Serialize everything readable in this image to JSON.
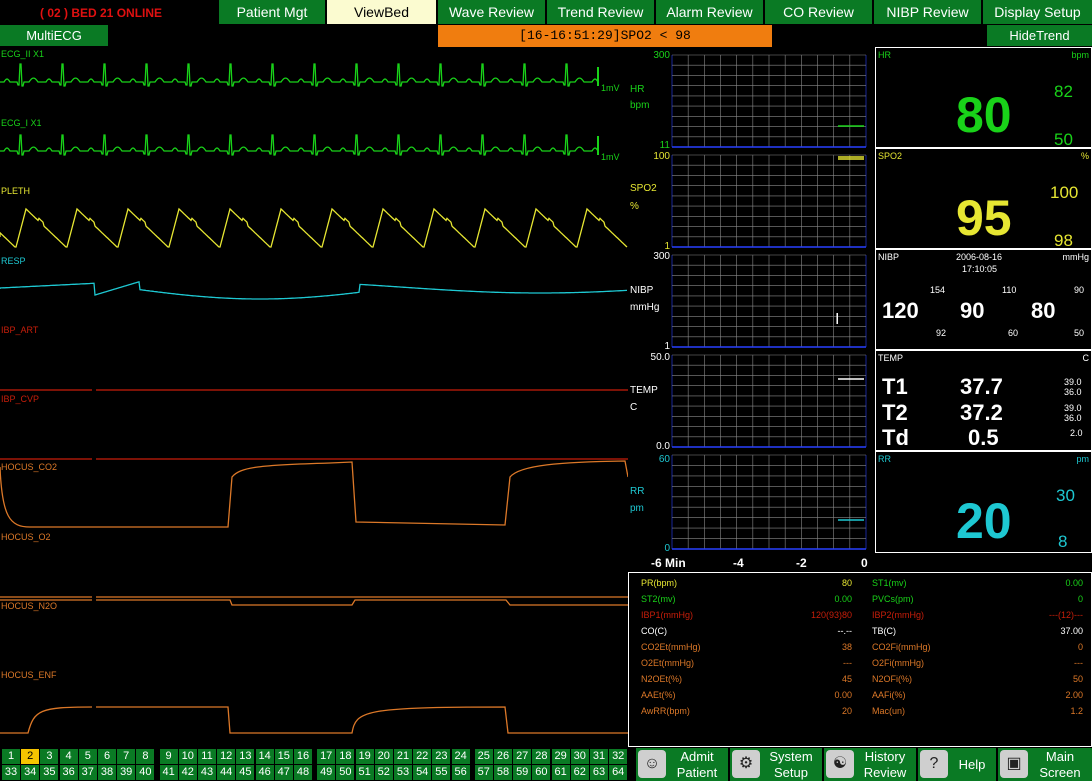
{
  "header": {
    "bed_status": "( 02 ) BED 21 ONLINE",
    "tabs": [
      {
        "label": "Patient Mgt",
        "active": false
      },
      {
        "label": "ViewBed",
        "active": true
      },
      {
        "label": "Wave Review",
        "active": false
      },
      {
        "label": "Trend Review",
        "active": false
      },
      {
        "label": "Alarm Review",
        "active": false
      },
      {
        "label": "CO Review",
        "active": false
      },
      {
        "label": "NIBP Review",
        "active": false
      },
      {
        "label": "Display Setup",
        "active": false
      }
    ],
    "multi_ecg": "MultiECG",
    "alarm": "[16-16:51:29]SPO2 < 98",
    "hide_trend": "HideTrend"
  },
  "colors": {
    "green": "#19d219",
    "yellow": "#e6e632",
    "cyan": "#1ec8d2",
    "red": "#c81e0a",
    "orange": "#dc7828",
    "menu_green": "#0a7a24",
    "grid_blue": "#1428d2"
  },
  "waves": [
    {
      "label": "ECG_II   X1",
      "color": "#19d219"
    },
    {
      "label": "ECG_I   X1",
      "color": "#19d219"
    },
    {
      "label": "PLETH",
      "color": "#e6e632"
    },
    {
      "label": "RESP",
      "color": "#1ec8d2"
    },
    {
      "label": "IBP_ART",
      "color": "#c81e0a"
    },
    {
      "label": "IBP_CVP",
      "color": "#c81e0a"
    },
    {
      "label": "HOCUS_CO2",
      "color": "#dc7828"
    },
    {
      "label": "HOCUS_O2",
      "color": "#dc7828"
    },
    {
      "label": "HOCUS_N2O",
      "color": "#dc7828"
    },
    {
      "label": "HOCUS_ENF",
      "color": "#dc7828"
    }
  ],
  "ecg_scale": "1mV",
  "trends": [
    {
      "name": "HR",
      "unit": "bpm",
      "top": "300",
      "bottom": "11",
      "color": "#19d219"
    },
    {
      "name": "SPO2",
      "unit": "%",
      "top": "100",
      "bottom": "1",
      "color": "#e6e632"
    },
    {
      "name": "NIBP",
      "unit": "mmHg",
      "top": "300",
      "bottom": "1",
      "color": "#ffffff"
    },
    {
      "name": "TEMP",
      "unit": "C",
      "top": "50.0",
      "bottom": "0.0",
      "color": "#ffffff"
    },
    {
      "name": "RR",
      "unit": "pm",
      "top": "60",
      "bottom": "0",
      "color": "#1ec8d2"
    }
  ],
  "trend_axis": [
    "-6 Min",
    "-4",
    "-2",
    "0"
  ],
  "params": {
    "hr": {
      "title": "HR",
      "unit": "bpm",
      "value": "80",
      "hi": "82",
      "lo": "50"
    },
    "spo2": {
      "title": "SPO2",
      "unit": "%",
      "value": "95",
      "hi": "100",
      "lo": "98"
    },
    "nibp": {
      "title": "NIBP",
      "unit": "mmHg",
      "date": "2006-08-16",
      "time": "17:10:05",
      "sys": "120",
      "dia": "90",
      "map": "80",
      "sys_hi": "154",
      "sys_lo": "92",
      "dia_hi": "110",
      "dia_lo": "60",
      "map_hi": "90",
      "map_lo": "50"
    },
    "temp": {
      "title": "TEMP",
      "unit": "C",
      "t1_label": "T1",
      "t1": "37.7",
      "t1_hi": "39.0",
      "t1_lo": "36.0",
      "t2_label": "T2",
      "t2": "37.2",
      "t2_hi": "39.0",
      "t2_lo": "36.0",
      "td_label": "Td",
      "td": "0.5",
      "td_hi": "2.0"
    },
    "rr": {
      "title": "RR",
      "unit": "pm",
      "value": "20",
      "hi": "30",
      "lo": "8"
    }
  },
  "table_left": [
    {
      "label": "PR(bpm)",
      "value": "80",
      "color": "#e6e632"
    },
    {
      "label": "ST2(mv)",
      "value": "0.00",
      "color": "#19d219"
    },
    {
      "label": "IBP1(mmHg)",
      "value": "120(93)80",
      "color": "#c81e0a"
    },
    {
      "label": "CO(C)",
      "value": "--.--",
      "color": "#ffffff"
    },
    {
      "label": "CO2Et(mmHg)",
      "value": "38",
      "color": "#dc7828"
    },
    {
      "label": "O2Et(mmHg)",
      "value": "---",
      "color": "#dc7828"
    },
    {
      "label": "N2OEt(%)",
      "value": "45",
      "color": "#dc7828"
    },
    {
      "label": "AAEt(%)",
      "value": "0.00",
      "color": "#dc7828"
    },
    {
      "label": "AwRR(bpm)",
      "value": "20",
      "color": "#dc7828"
    }
  ],
  "table_right": [
    {
      "label": "ST1(mv)",
      "value": "0.00",
      "color": "#19d219"
    },
    {
      "label": "PVCs(pm)",
      "value": "0",
      "color": "#19d219"
    },
    {
      "label": "IBP2(mmHg)",
      "value": "---(12)---",
      "color": "#c81e0a"
    },
    {
      "label": "TB(C)",
      "value": "37.00",
      "color": "#ffffff"
    },
    {
      "label": "CO2Fi(mmHg)",
      "value": "0",
      "color": "#dc7828"
    },
    {
      "label": "O2Fi(mmHg)",
      "value": "---",
      "color": "#dc7828"
    },
    {
      "label": "N2OFi(%)",
      "value": "50",
      "color": "#dc7828"
    },
    {
      "label": "AAFi(%)",
      "value": "2.00",
      "color": "#dc7828"
    },
    {
      "label": "Mac(un)",
      "value": "1.2",
      "color": "#dc7828"
    }
  ],
  "beds_row1": [
    "1",
    "2",
    "3",
    "4",
    "5",
    "6",
    "7",
    "8",
    "9",
    "10",
    "11",
    "12",
    "13",
    "14",
    "15",
    "16",
    "17",
    "18",
    "19",
    "20",
    "21",
    "22",
    "23",
    "24",
    "25",
    "26",
    "27",
    "28",
    "29",
    "30",
    "31",
    "32"
  ],
  "beds_row2": [
    "33",
    "34",
    "35",
    "36",
    "37",
    "38",
    "39",
    "40",
    "41",
    "42",
    "43",
    "44",
    "45",
    "46",
    "47",
    "48",
    "49",
    "50",
    "51",
    "52",
    "53",
    "54",
    "55",
    "56",
    "57",
    "58",
    "59",
    "60",
    "61",
    "62",
    "63",
    "64"
  ],
  "selected_bed": "2",
  "bottom_buttons": [
    {
      "line1": "Admit",
      "line2": "Patient",
      "icon": "admit-patient-icon"
    },
    {
      "line1": "System",
      "line2": "Setup",
      "icon": "system-setup-icon"
    },
    {
      "line1": "History",
      "line2": "Review",
      "icon": "history-review-icon"
    },
    {
      "line1": "Help",
      "line2": "",
      "icon": "help-icon"
    },
    {
      "line1": "Main",
      "line2": "Screen",
      "icon": "main-screen-icon"
    }
  ]
}
